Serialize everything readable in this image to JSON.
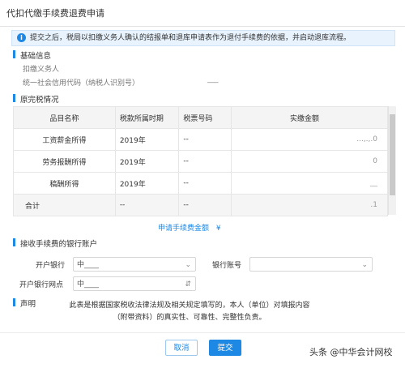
{
  "window": {
    "title": "代扣代缴手续费退费申请"
  },
  "notice": {
    "icon": "info-icon",
    "text": "提交之后，税局以扣缴义务人确认的结报单和退库申请表作为退付手续费的依据，并启动退库流程。"
  },
  "basic_info": {
    "section_title": "基础信息",
    "withholding_agent_label": "扣缴义务人",
    "withholding_agent_value": "",
    "credit_code_label": "统一社会信用代码（纳税人识别号）",
    "credit_code_value": "___"
  },
  "tax_table": {
    "section_title": "原完税情况",
    "headers": [
      "品目名称",
      "税款所属时期",
      "税票号码",
      "实缴金额"
    ],
    "rows": [
      [
        "工资薪金所得",
        "2019年",
        "--",
        "...,.,.0"
      ],
      [
        "劳务报酬所得",
        "2019年",
        "--",
        "0"
      ],
      [
        "稿酬所得",
        "2019年",
        "--",
        "__"
      ]
    ],
    "total_row": [
      "合计",
      "--",
      "--",
      ".1"
    ]
  },
  "refund": {
    "label": "申请手续费金额",
    "value": "¥"
  },
  "bank": {
    "section_title": "接收手续费的银行账户",
    "bank_label": "开户银行",
    "bank_value": "中____",
    "account_label": "银行账号",
    "account_value": "",
    "branch_label": "开户银行网点",
    "branch_value": "中____"
  },
  "declaration": {
    "section_title": "声明",
    "text": "此表是根据国家税收法律法规及相关规定填写的，本人（单位）对填报内容（附带资料）的真实性、可靠性、完整性负责。"
  },
  "buttons": {
    "cancel": "取消",
    "submit": "提交"
  },
  "watermark": "头条 @中华会计网校"
}
